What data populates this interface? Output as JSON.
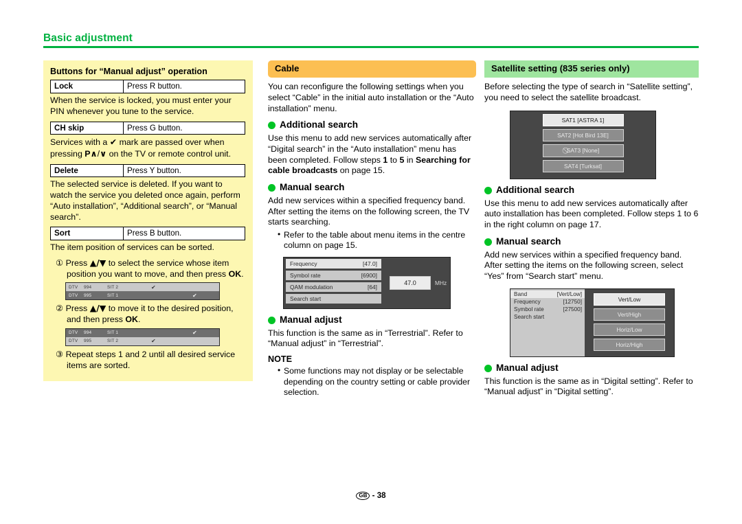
{
  "running_head": {
    "title": "Basic adjustment",
    "rule_color": "#00b140"
  },
  "footer": {
    "region": "GB",
    "separator": "-",
    "page": "38"
  },
  "left_panel": {
    "title": "Buttons for “Manual adjust” operation",
    "background": "#fdf7b2",
    "rows": [
      {
        "key": "Lock",
        "value": "Press R button."
      },
      {
        "key": "CH skip",
        "value": "Press G button."
      },
      {
        "key": "Delete",
        "value": "Press Y button."
      },
      {
        "key": "Sort",
        "value": "Press B button."
      }
    ],
    "lock_desc": "When the service is locked, you must enter your PIN whenever you tune to the service.",
    "chskip_desc_a": "Services with a ",
    "chskip_check": "✔",
    "chskip_desc_b": " mark are passed over when pressing ",
    "chskip_p": "P",
    "chskip_up": "∧",
    "chskip_slash": "/",
    "chskip_down": "∨",
    "chskip_desc_c": " on the TV or remote control unit.",
    "delete_desc": "The selected service is deleted. If you want to watch the service you deleted once again, perform “Auto installation”, “Additional search”, or “Manual search”.",
    "sort_desc": "The item position of services can be sorted.",
    "steps": [
      {
        "num": "①",
        "text_a": "Press ",
        "ud": "▲/▼",
        "text_b": " to select the service whose item position you want to move, and then press ",
        "bold": "OK",
        "text_c": "."
      },
      {
        "num": "②",
        "text_a": "Press ",
        "ud": "▲/▼",
        "text_b": " to move it to the desired position, and then press ",
        "bold": "OK",
        "text_c": "."
      },
      {
        "num": "③",
        "text_a": "Repeat steps 1 and 2 until all desired service items are sorted.",
        "ud": "",
        "text_b": "",
        "bold": "",
        "text_c": ""
      }
    ],
    "sort_list_1": {
      "rows": [
        {
          "type": "DTV",
          "num": "994",
          "name": "SIT 2",
          "check_col": "left",
          "check": "✔",
          "style": "light"
        },
        {
          "type": "DTV",
          "num": "995",
          "name": "SIT 1",
          "check_col": "right",
          "check": "✔",
          "style": "dark"
        }
      ]
    },
    "sort_list_2": {
      "rows": [
        {
          "type": "DTV",
          "num": "994",
          "name": "SIT 1",
          "check_col": "right",
          "check": "✔",
          "style": "dark"
        },
        {
          "type": "DTV",
          "num": "995",
          "name": "SIT 2",
          "check_col": "left",
          "check": "✔",
          "style": "light"
        }
      ]
    }
  },
  "cable": {
    "header": "Cable",
    "header_color": "#fcbf52",
    "intro": "You can reconfigure the following settings when you select “Cable” in the initial auto installation or the “Auto installation” menu.",
    "additional_search": {
      "title": "Additional search",
      "text_a": "Use this menu to add new services automatically after “Digital search” in the “Auto installation” menu has been completed. Follow steps ",
      "step_from": "1",
      "text_b": " to ",
      "step_to": "5",
      "text_c": " in ",
      "ref_bold": "Searching for cable broadcasts",
      "text_d": " on page 15."
    },
    "manual_search": {
      "title": "Manual search",
      "text": "Add new services within a specified frequency band. After setting the items on the following screen, the TV starts searching.",
      "bullets": [
        "Refer to the table about menu items in the centre column on page 15."
      ],
      "osd": {
        "items": [
          {
            "label": "Frequency",
            "value": "[47.0]",
            "selected": true
          },
          {
            "label": "Symbol rate",
            "value": "[6900]",
            "selected": false
          },
          {
            "label": "QAM modulation",
            "value": "[64]",
            "selected": false
          },
          {
            "label": "Search start",
            "value": "",
            "selected": false
          }
        ],
        "value_box": "47.0",
        "unit": "MHz"
      }
    },
    "manual_adjust": {
      "title": "Manual adjust",
      "text": "This function is the same as in “Terrestrial”. Refer to “Manual adjust” in “Terrestrial”."
    },
    "note": {
      "title": "NOTE",
      "bullets": [
        "Some functions may not display or be selectable depending on the country setting or cable provider selection."
      ]
    }
  },
  "satellite": {
    "header": "Satellite setting (835 series only)",
    "header_color": "#9fe59f",
    "intro": "Before selecting the type of search in “Satellite setting”, you need to select the satellite broadcast.",
    "sat_osd": {
      "buttons": [
        {
          "label": "SAT1 [ASTRA 1]",
          "selected": true,
          "disabled": false,
          "icon": ""
        },
        {
          "label": "SAT2 [Hot Bird 13E]",
          "selected": false,
          "disabled": false,
          "icon": ""
        },
        {
          "label": "SAT3 [None]",
          "selected": false,
          "disabled": true,
          "icon": "⃠"
        },
        {
          "label": "SAT4 [Turksat]",
          "selected": false,
          "disabled": false,
          "icon": ""
        }
      ]
    },
    "additional_search": {
      "title": "Additional search",
      "text": "Use this menu to add new services automatically after auto installation has been completed. Follow steps 1 to 6 in the right column on page 17."
    },
    "manual_search": {
      "title": "Manual search",
      "text": "Add new services within a specified frequency band. After setting the items on the following screen, select “Yes” from “Search start” menu.",
      "osd": {
        "items": [
          {
            "label": "Band",
            "value": "[Vert/Low]",
            "selected": true
          },
          {
            "label": "Frequency",
            "value": "[12750]",
            "selected": false
          },
          {
            "label": "Symbol rate",
            "value": "[27500]",
            "selected": false
          },
          {
            "label": "Search start",
            "value": "",
            "selected": false
          }
        ],
        "buttons": [
          {
            "label": "Vert/Low",
            "selected": true
          },
          {
            "label": "Vert/High",
            "selected": false
          },
          {
            "label": "Horiz/Low",
            "selected": false
          },
          {
            "label": "Horiz/High",
            "selected": false
          }
        ]
      }
    },
    "manual_adjust": {
      "title": "Manual adjust",
      "text": "This function is the same as in “Digital setting”. Refer to “Manual adjust” in “Digital setting”."
    }
  }
}
